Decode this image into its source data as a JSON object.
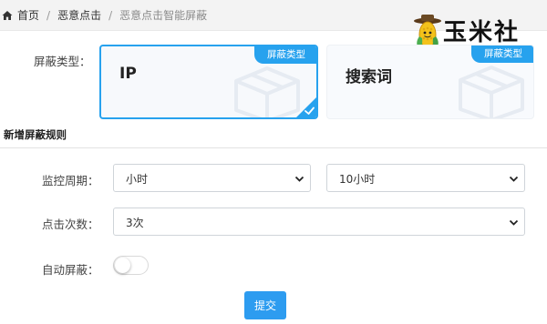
{
  "breadcrumb": {
    "items": [
      "首页",
      "恶意点击",
      "恶意点击智能屏蔽"
    ],
    "separator": "/"
  },
  "logo": {
    "text": "玉米社"
  },
  "block_type": {
    "label": "屏蔽类型：",
    "options": [
      {
        "name": "IP",
        "badge": "屏蔽类型",
        "selected": true
      },
      {
        "name": "搜索词",
        "badge": "屏蔽类型",
        "selected": false
      }
    ]
  },
  "new_rule": {
    "title": "新增屏蔽规则",
    "monitor_period": {
      "label": "监控周期：",
      "unit_value": "小时",
      "duration_value": "10小时"
    },
    "click_count": {
      "label": "点击次数：",
      "value": "3次"
    },
    "auto_block": {
      "label": "自动屏蔽：",
      "enabled": false
    },
    "submit_label": "提交"
  },
  "colors": {
    "accent": "#27a2ee",
    "button": "#2d9cf0",
    "breadcrumb_bg": "#f3f3f3"
  },
  "icons": [
    "home-icon",
    "cube-icon",
    "check-icon",
    "chevron-down-icon",
    "corn-mascot-icon"
  ]
}
